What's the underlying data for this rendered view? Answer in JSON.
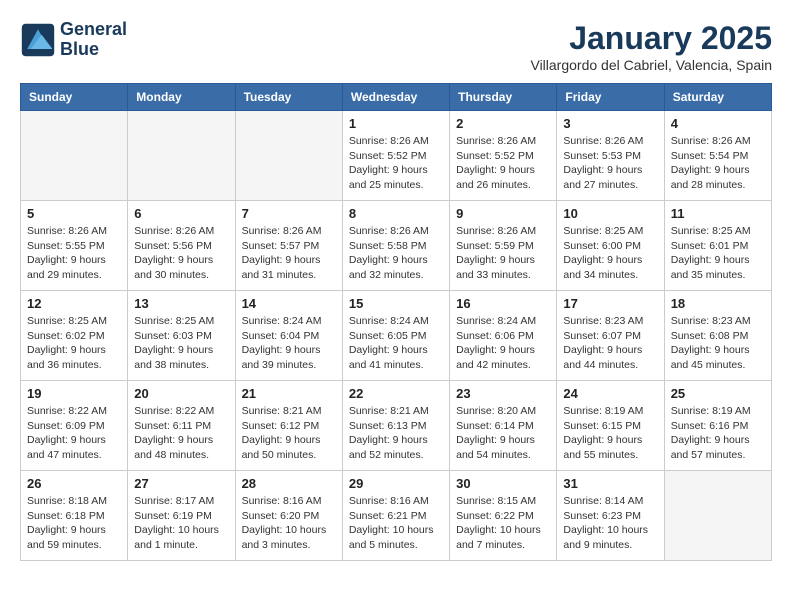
{
  "logo": {
    "line1": "General",
    "line2": "Blue"
  },
  "title": "January 2025",
  "location": "Villargordo del Cabriel, Valencia, Spain",
  "weekdays": [
    "Sunday",
    "Monday",
    "Tuesday",
    "Wednesday",
    "Thursday",
    "Friday",
    "Saturday"
  ],
  "weeks": [
    [
      {
        "day": "",
        "info": ""
      },
      {
        "day": "",
        "info": ""
      },
      {
        "day": "",
        "info": ""
      },
      {
        "day": "1",
        "sunrise": "Sunrise: 8:26 AM",
        "sunset": "Sunset: 5:52 PM",
        "daylight": "Daylight: 9 hours and 25 minutes."
      },
      {
        "day": "2",
        "sunrise": "Sunrise: 8:26 AM",
        "sunset": "Sunset: 5:52 PM",
        "daylight": "Daylight: 9 hours and 26 minutes."
      },
      {
        "day": "3",
        "sunrise": "Sunrise: 8:26 AM",
        "sunset": "Sunset: 5:53 PM",
        "daylight": "Daylight: 9 hours and 27 minutes."
      },
      {
        "day": "4",
        "sunrise": "Sunrise: 8:26 AM",
        "sunset": "Sunset: 5:54 PM",
        "daylight": "Daylight: 9 hours and 28 minutes."
      }
    ],
    [
      {
        "day": "5",
        "sunrise": "Sunrise: 8:26 AM",
        "sunset": "Sunset: 5:55 PM",
        "daylight": "Daylight: 9 hours and 29 minutes."
      },
      {
        "day": "6",
        "sunrise": "Sunrise: 8:26 AM",
        "sunset": "Sunset: 5:56 PM",
        "daylight": "Daylight: 9 hours and 30 minutes."
      },
      {
        "day": "7",
        "sunrise": "Sunrise: 8:26 AM",
        "sunset": "Sunset: 5:57 PM",
        "daylight": "Daylight: 9 hours and 31 minutes."
      },
      {
        "day": "8",
        "sunrise": "Sunrise: 8:26 AM",
        "sunset": "Sunset: 5:58 PM",
        "daylight": "Daylight: 9 hours and 32 minutes."
      },
      {
        "day": "9",
        "sunrise": "Sunrise: 8:26 AM",
        "sunset": "Sunset: 5:59 PM",
        "daylight": "Daylight: 9 hours and 33 minutes."
      },
      {
        "day": "10",
        "sunrise": "Sunrise: 8:25 AM",
        "sunset": "Sunset: 6:00 PM",
        "daylight": "Daylight: 9 hours and 34 minutes."
      },
      {
        "day": "11",
        "sunrise": "Sunrise: 8:25 AM",
        "sunset": "Sunset: 6:01 PM",
        "daylight": "Daylight: 9 hours and 35 minutes."
      }
    ],
    [
      {
        "day": "12",
        "sunrise": "Sunrise: 8:25 AM",
        "sunset": "Sunset: 6:02 PM",
        "daylight": "Daylight: 9 hours and 36 minutes."
      },
      {
        "day": "13",
        "sunrise": "Sunrise: 8:25 AM",
        "sunset": "Sunset: 6:03 PM",
        "daylight": "Daylight: 9 hours and 38 minutes."
      },
      {
        "day": "14",
        "sunrise": "Sunrise: 8:24 AM",
        "sunset": "Sunset: 6:04 PM",
        "daylight": "Daylight: 9 hours and 39 minutes."
      },
      {
        "day": "15",
        "sunrise": "Sunrise: 8:24 AM",
        "sunset": "Sunset: 6:05 PM",
        "daylight": "Daylight: 9 hours and 41 minutes."
      },
      {
        "day": "16",
        "sunrise": "Sunrise: 8:24 AM",
        "sunset": "Sunset: 6:06 PM",
        "daylight": "Daylight: 9 hours and 42 minutes."
      },
      {
        "day": "17",
        "sunrise": "Sunrise: 8:23 AM",
        "sunset": "Sunset: 6:07 PM",
        "daylight": "Daylight: 9 hours and 44 minutes."
      },
      {
        "day": "18",
        "sunrise": "Sunrise: 8:23 AM",
        "sunset": "Sunset: 6:08 PM",
        "daylight": "Daylight: 9 hours and 45 minutes."
      }
    ],
    [
      {
        "day": "19",
        "sunrise": "Sunrise: 8:22 AM",
        "sunset": "Sunset: 6:09 PM",
        "daylight": "Daylight: 9 hours and 47 minutes."
      },
      {
        "day": "20",
        "sunrise": "Sunrise: 8:22 AM",
        "sunset": "Sunset: 6:11 PM",
        "daylight": "Daylight: 9 hours and 48 minutes."
      },
      {
        "day": "21",
        "sunrise": "Sunrise: 8:21 AM",
        "sunset": "Sunset: 6:12 PM",
        "daylight": "Daylight: 9 hours and 50 minutes."
      },
      {
        "day": "22",
        "sunrise": "Sunrise: 8:21 AM",
        "sunset": "Sunset: 6:13 PM",
        "daylight": "Daylight: 9 hours and 52 minutes."
      },
      {
        "day": "23",
        "sunrise": "Sunrise: 8:20 AM",
        "sunset": "Sunset: 6:14 PM",
        "daylight": "Daylight: 9 hours and 54 minutes."
      },
      {
        "day": "24",
        "sunrise": "Sunrise: 8:19 AM",
        "sunset": "Sunset: 6:15 PM",
        "daylight": "Daylight: 9 hours and 55 minutes."
      },
      {
        "day": "25",
        "sunrise": "Sunrise: 8:19 AM",
        "sunset": "Sunset: 6:16 PM",
        "daylight": "Daylight: 9 hours and 57 minutes."
      }
    ],
    [
      {
        "day": "26",
        "sunrise": "Sunrise: 8:18 AM",
        "sunset": "Sunset: 6:18 PM",
        "daylight": "Daylight: 9 hours and 59 minutes."
      },
      {
        "day": "27",
        "sunrise": "Sunrise: 8:17 AM",
        "sunset": "Sunset: 6:19 PM",
        "daylight": "Daylight: 10 hours and 1 minute."
      },
      {
        "day": "28",
        "sunrise": "Sunrise: 8:16 AM",
        "sunset": "Sunset: 6:20 PM",
        "daylight": "Daylight: 10 hours and 3 minutes."
      },
      {
        "day": "29",
        "sunrise": "Sunrise: 8:16 AM",
        "sunset": "Sunset: 6:21 PM",
        "daylight": "Daylight: 10 hours and 5 minutes."
      },
      {
        "day": "30",
        "sunrise": "Sunrise: 8:15 AM",
        "sunset": "Sunset: 6:22 PM",
        "daylight": "Daylight: 10 hours and 7 minutes."
      },
      {
        "day": "31",
        "sunrise": "Sunrise: 8:14 AM",
        "sunset": "Sunset: 6:23 PM",
        "daylight": "Daylight: 10 hours and 9 minutes."
      },
      {
        "day": "",
        "info": ""
      }
    ]
  ]
}
